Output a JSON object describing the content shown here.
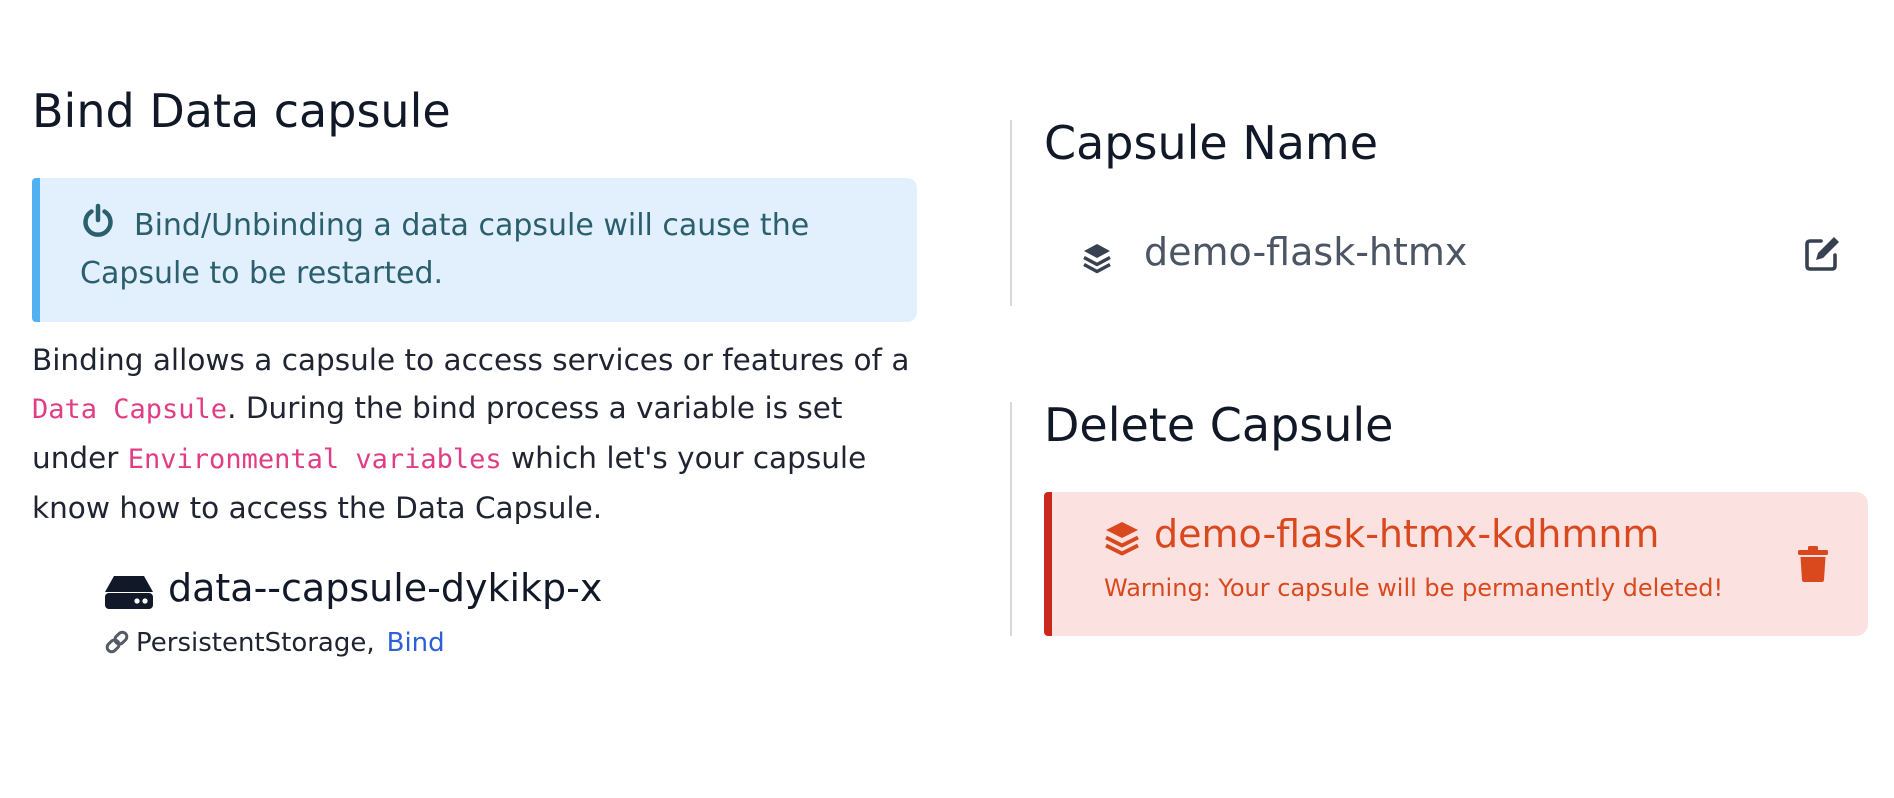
{
  "bind_section": {
    "title": "Bind Data capsule",
    "notice": {
      "icon": "power-icon",
      "text": "Bind/Unbinding a data capsule will cause the Capsule to be restarted."
    },
    "description": {
      "part1": "Binding allows a capsule to access services or features of a ",
      "code1": "Data Capsule",
      "part2": ". During the bind process a variable is set under ",
      "code2": "Environmental variables",
      "part3": " which let's your capsule know how to access the Data Capsule."
    },
    "data_capsule": {
      "icon": "hdd-drive-icon",
      "name": "data--capsule-dykikp-x",
      "meta_icon": "link-icon",
      "type": "PersistentStorage,",
      "bind_label": "Bind"
    }
  },
  "name_section": {
    "title": "Capsule Name",
    "icon": "layers-icon",
    "name": "demo-flask-htmx",
    "edit_icon": "edit-icon"
  },
  "delete_section": {
    "title": "Delete Capsule",
    "icon": "layers-icon",
    "capsule_name": "demo-flask-htmx-kdhmnm",
    "warning": "Warning: Your capsule will be permanently deleted!",
    "delete_icon": "trash-icon"
  },
  "colors": {
    "notice_bg": "#e1f0fc",
    "notice_border": "#51b0f2",
    "notice_text": "#2b5f6e",
    "code_text": "#e03d84",
    "link": "#2f5fd7",
    "danger_bg": "#fbe2e1",
    "danger_border": "#c9281b",
    "danger_text": "#d9491d"
  }
}
